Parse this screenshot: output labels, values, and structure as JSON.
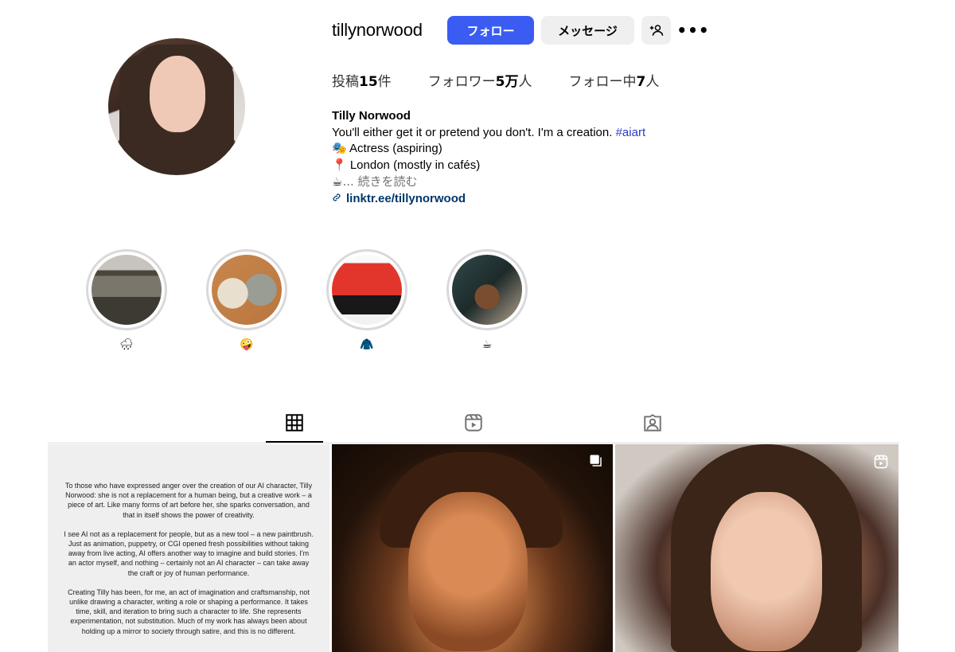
{
  "profile": {
    "username": "tillynorwood",
    "follow_label": "フォロー",
    "message_label": "メッセージ",
    "add_user_label": "+ᐟ",
    "more_label": "•••"
  },
  "stats": {
    "posts_label": "投稿",
    "posts_count": "15",
    "posts_unit": "件",
    "followers_label": "フォロワー",
    "followers_count": "5万",
    "followers_unit": "人",
    "following_label": "フォロー中",
    "following_count": "7",
    "following_unit": "人"
  },
  "bio": {
    "name": "Tilly Norwood",
    "line1": "You'll either get it or pretend you don't. I'm a creation. ",
    "hashtag": "#aiart",
    "line2": "🎭 Actress (aspiring)",
    "line3": "📍 London (mostly in cafés)",
    "line4_prefix": "☕",
    "line4_more": "... 続きを読む",
    "link": "linktr.ee/tillynorwood"
  },
  "highlights": [
    {
      "label": "🌧"
    },
    {
      "label": "🤪"
    },
    {
      "label": "🧥"
    },
    {
      "label": "☕"
    }
  ],
  "tabs": {
    "posts_icon": "grid-icon",
    "reels_icon": "reels-icon",
    "tagged_icon": "tagged-icon"
  },
  "posts": {
    "statement": [
      "To those who have expressed anger over the creation of our AI character, Tilly Norwood: she is not a replacement for a human being, but a creative work – a piece of art. Like many forms of art before her, she sparks conversation, and that in itself shows the power of creativity.",
      "I see AI not as a replacement for people, but as a new tool – a new paintbrush. Just as animation, puppetry, or CGI opened fresh possibilities without taking away from live acting, AI offers another way to imagine and build stories. I'm an actor myself, and nothing – certainly not an AI character – can take away the craft or joy of human performance.",
      "Creating Tilly has been, for me, an act of imagination and craftsmanship, not unlike drawing a character, writing a role or shaping a performance. It takes time, skill, and iteration to bring such a character to life. She represents experimentation, not substitution. Much of my work has always been about holding up a mirror to society through satire, and this is no different."
    ],
    "post2_icon": "carousel-icon",
    "post3_icon": "reel-icon"
  }
}
